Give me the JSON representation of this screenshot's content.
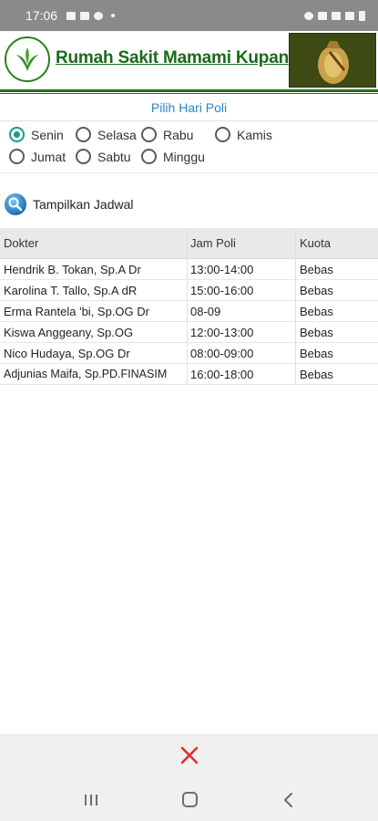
{
  "status_bar": {
    "time": "17:06"
  },
  "header": {
    "hospital_name": "Rumah Sakit Mamami Kupang"
  },
  "section_title": "Pilih Hari Poli",
  "days": [
    {
      "label": "Senin",
      "checked": true
    },
    {
      "label": "Selasa",
      "checked": false
    },
    {
      "label": "Rabu",
      "checked": false
    },
    {
      "label": "Kamis",
      "checked": false
    },
    {
      "label": "Jumat",
      "checked": false
    },
    {
      "label": "Sabtu",
      "checked": false
    },
    {
      "label": "Minggu",
      "checked": false
    }
  ],
  "show_button_label": "Tampilkan Jadwal",
  "table": {
    "headers": [
      "Dokter",
      "Jam Poli",
      "Kuota"
    ],
    "rows": [
      [
        "Hendrik B. Tokan, Sp.A Dr",
        "13:00-14:00",
        "Bebas"
      ],
      [
        "Karolina T. Tallo, Sp.A dR",
        "15:00-16:00",
        "Bebas"
      ],
      [
        "Erma Rantela 'bi, Sp.OG Dr",
        "08-09",
        "Bebas"
      ],
      [
        "Kiswa Anggeany, Sp.OG",
        "12:00-13:00",
        "Bebas"
      ],
      [
        "Nico Hudaya, Sp.OG Dr",
        "08:00-09:00",
        "Bebas"
      ],
      [
        "Adjunias Maifa, Sp.PD.FINASIM",
        "16:00-18:00",
        "Bebas"
      ]
    ]
  },
  "colors": {
    "brand_green": "#1b6a1b",
    "accent_teal": "#1a9c86",
    "title_blue": "#2a86c8",
    "close_red": "#d9302c"
  }
}
